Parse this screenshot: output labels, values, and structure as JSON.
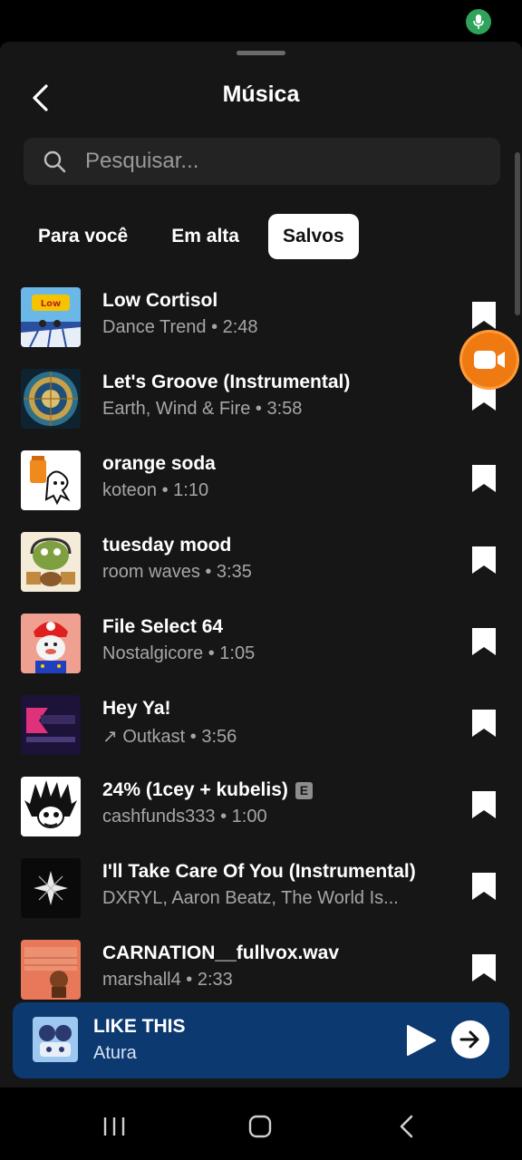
{
  "header": {
    "title": "Música",
    "back_icon": "chevron-left-icon"
  },
  "search": {
    "placeholder": "Pesquisar...",
    "value": "",
    "icon": "search-icon"
  },
  "tabs": [
    {
      "label": "Para você",
      "active": false
    },
    {
      "label": "Em alta",
      "active": false
    },
    {
      "label": "Salvos",
      "active": true
    }
  ],
  "songs": [
    {
      "title": "Low Cortisol",
      "meta": "Dance Trend • 2:48",
      "explicit": false,
      "saved": true
    },
    {
      "title": "Let's Groove (Instrumental)",
      "meta": "Earth, Wind & Fire • 3:58",
      "explicit": false,
      "saved": true
    },
    {
      "title": "orange soda",
      "meta": "koteon • 1:10",
      "explicit": false,
      "saved": true
    },
    {
      "title": "tuesday mood",
      "meta": "room waves • 3:35",
      "explicit": false,
      "saved": true
    },
    {
      "title": "File Select 64",
      "meta": "Nostalgicore • 1:05",
      "explicit": false,
      "saved": true
    },
    {
      "title": "Hey Ya!",
      "meta": "↗ Outkast • 3:56",
      "explicit": false,
      "saved": true
    },
    {
      "title": "24% (1cey + kubelis)",
      "meta": "cashfunds333 • 1:00",
      "explicit": true,
      "explicit_label": "E",
      "saved": true
    },
    {
      "title": "I'll Take Care Of You (Instrumental)",
      "meta": "DXRYL, Aaron Beatz, The World Is...",
      "explicit": false,
      "saved": true
    },
    {
      "title": "CARNATION__fullvox.wav",
      "meta": "marshall4 • 2:33",
      "explicit": false,
      "saved": true
    }
  ],
  "player": {
    "title": "LIKE THIS",
    "artist": "Atura",
    "play_icon": "play-icon",
    "next_icon": "arrow-right-icon"
  },
  "colors": {
    "sheet_bg": "#161616",
    "player_bg": "#0c3a70",
    "record_button": "#f07a12",
    "mic_indicator": "#2fa35a"
  },
  "nav": {
    "recents_icon": "recents-icon",
    "home_icon": "home-icon",
    "back_icon": "back-icon"
  }
}
